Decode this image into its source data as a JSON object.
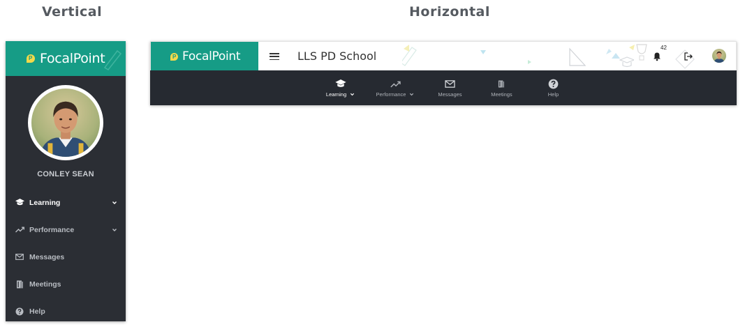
{
  "captions": {
    "vertical": "Vertical",
    "horizontal": "Horizontal"
  },
  "brand": {
    "name": "FocalPoint",
    "color": "#169c86",
    "mark_color": "#f3d94a"
  },
  "vertical": {
    "user_name": "CONLEY SEAN",
    "nav": [
      {
        "label": "Learning",
        "icon": "graduation-cap-icon",
        "has_chevron": true,
        "active": true
      },
      {
        "label": "Performance",
        "icon": "trend-up-icon",
        "has_chevron": true,
        "active": false
      },
      {
        "label": "Messages",
        "icon": "envelope-icon",
        "has_chevron": false,
        "active": false
      },
      {
        "label": "Meetings",
        "icon": "door-icon",
        "has_chevron": false,
        "active": false
      },
      {
        "label": "Help",
        "icon": "question-circle-icon",
        "has_chevron": false,
        "active": false
      }
    ]
  },
  "horizontal": {
    "school_title": "LLS PD School",
    "notification_count": "42",
    "nav": [
      {
        "label": "Learning",
        "icon": "graduation-cap-icon",
        "has_chevron": true,
        "active": true
      },
      {
        "label": "Performance",
        "icon": "trend-up-icon",
        "has_chevron": true,
        "active": false
      },
      {
        "label": "Messages",
        "icon": "envelope-icon",
        "has_chevron": false,
        "active": false
      },
      {
        "label": "Meetings",
        "icon": "door-icon",
        "has_chevron": false,
        "active": false
      },
      {
        "label": "Help",
        "icon": "question-circle-icon",
        "has_chevron": false,
        "active": false
      }
    ]
  },
  "colors": {
    "nav_bg": "#2b2e34",
    "hnav_bg": "#262a31"
  }
}
